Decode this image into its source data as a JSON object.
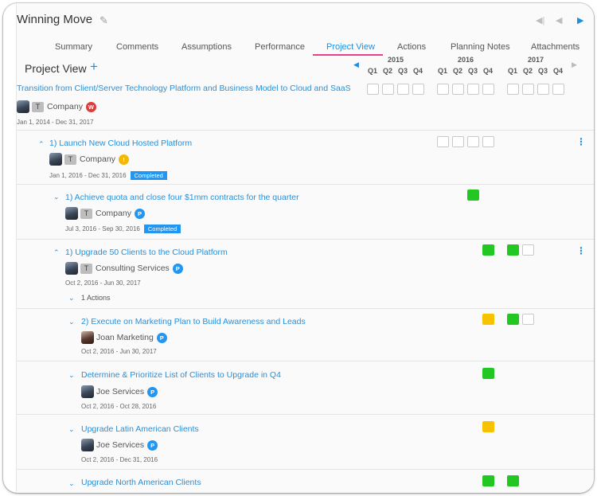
{
  "header": {
    "title": "Winning Move"
  },
  "tabs": [
    {
      "label": "Summary"
    },
    {
      "label": "Comments"
    },
    {
      "label": "Assumptions"
    },
    {
      "label": "Performance"
    },
    {
      "label": "Project View",
      "active": true
    },
    {
      "label": "Actions"
    },
    {
      "label": "Planning Notes"
    },
    {
      "label": "Attachments"
    }
  ],
  "project_view": {
    "title": "Project View",
    "add_icon": "plus-icon"
  },
  "timeline": {
    "years": [
      "2015",
      "2016",
      "2017"
    ],
    "quarters": [
      "Q1",
      "Q2",
      "Q3",
      "Q4",
      "Q1",
      "Q2",
      "Q3",
      "Q4",
      "Q1",
      "Q2",
      "Q3",
      "Q4"
    ]
  },
  "colors": {
    "link": "#2a8fd8",
    "green": "#22c722",
    "yellow": "#f7c200",
    "badge_red": "#e03c3c",
    "badge_yellow": "#f5b800",
    "badge_blue": "#2196f3",
    "tab_underline": "#e8408a"
  },
  "rows": [
    {
      "title": "Transition from Client/Server Technology Platform and Business Model to Cloud and SaaS",
      "owner": "Company",
      "type_badge": "T",
      "status_badge": "W",
      "status_color": "red",
      "dates": "Jan 1, 2014 - Dec 31, 2017",
      "cells": [
        "empty",
        "empty",
        "empty",
        "empty",
        "empty",
        "empty",
        "empty",
        "empty",
        "empty",
        "empty",
        "empty",
        "empty"
      ]
    },
    {
      "title": "1) Launch New Cloud Hosted Platform",
      "owner": "Company",
      "type_badge": "T",
      "status_badge": "!",
      "status_color": "yellow",
      "dates": "Jan 1, 2016 - Dec 31, 2016",
      "tag": "Completed",
      "cells": [
        "",
        "",
        "",
        "",
        "empty",
        "empty",
        "empty",
        "empty",
        "",
        "",
        "",
        ""
      ]
    },
    {
      "title": "1) Achieve quota and close four $1mm contracts for the quarter",
      "owner": "Company",
      "type_badge": "T",
      "status_badge": "P",
      "status_color": "blue",
      "dates": "Jul 3, 2016 - Sep 30, 2016",
      "tag": "Completed",
      "cells": [
        "",
        "",
        "",
        "",
        "",
        "",
        "green",
        "",
        "",
        "",
        "",
        ""
      ]
    },
    {
      "title": "1) Upgrade 50 Clients to the Cloud Platform",
      "owner": "Consulting Services",
      "type_badge": "T",
      "status_badge": "P",
      "status_color": "blue",
      "dates": "Oct 2, 2016 - Jun 30, 2017",
      "actions": "1 Actions",
      "cells": [
        "",
        "",
        "",
        "",
        "",
        "",
        "",
        "green",
        "green",
        "empty",
        "",
        ""
      ]
    },
    {
      "title": "2) Execute on Marketing Plan to Build Awareness and Leads",
      "owner": "Joan Marketing",
      "status_badge": "P",
      "status_color": "blue",
      "dates": "Oct 2, 2016 - Jun 30, 2017",
      "cells": [
        "",
        "",
        "",
        "",
        "",
        "",
        "",
        "yellow",
        "green",
        "empty",
        "",
        ""
      ]
    },
    {
      "title": "Determine & Prioritize List of Clients to Upgrade in Q4",
      "owner": "Joe Services",
      "status_badge": "P",
      "status_color": "blue",
      "dates": "Oct 2, 2016 - Oct 28, 2016",
      "cells": [
        "",
        "",
        "",
        "",
        "",
        "",
        "",
        "green",
        "",
        "",
        "",
        ""
      ]
    },
    {
      "title": "Upgrade Latin American Clients",
      "owner": "Joe Services",
      "status_badge": "P",
      "status_color": "blue",
      "dates": "Oct 2, 2016 - Dec 31, 2016",
      "cells": [
        "",
        "",
        "",
        "",
        "",
        "",
        "",
        "yellow",
        "",
        "",
        "",
        ""
      ]
    },
    {
      "title": "Upgrade North American Clients",
      "cells": [
        "",
        "",
        "",
        "",
        "",
        "",
        "",
        "green",
        "green",
        "",
        "",
        ""
      ]
    }
  ]
}
